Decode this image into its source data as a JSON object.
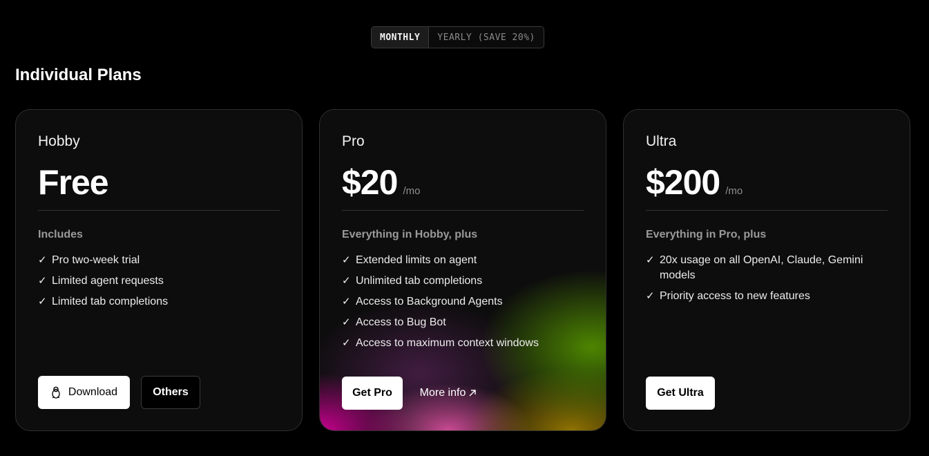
{
  "billing_toggle": {
    "monthly": "MONTHLY",
    "yearly": "YEARLY (SAVE 20%)"
  },
  "section_title": "Individual Plans",
  "plans": [
    {
      "name": "Hobby",
      "price": "Free",
      "per": "",
      "includes": "Includes",
      "features": [
        "Pro two-week trial",
        "Limited agent requests",
        "Limited tab completions"
      ],
      "primary_button": "Download",
      "secondary_button": "Others"
    },
    {
      "name": "Pro",
      "price": "$20",
      "per": "/mo",
      "includes": "Everything in Hobby, plus",
      "features": [
        "Extended limits on agent",
        "Unlimited tab completions",
        "Access to Background Agents",
        "Access to Bug Bot",
        "Access to maximum context windows"
      ],
      "primary_button": "Get Pro",
      "secondary_button": "More info",
      "secondary_icon": "arrow-up-right-icon"
    },
    {
      "name": "Ultra",
      "price": "$200",
      "per": "/mo",
      "includes": "Everything in Pro, plus",
      "features": [
        "20x usage on all OpenAI, Claude, Gemini models",
        "Priority access to new features"
      ],
      "primary_button": "Get Ultra"
    }
  ],
  "icons": {
    "check": "check-icon",
    "download": "linux-penguin-icon"
  },
  "check_glyph": "✓",
  "colors": {
    "background": "#000000",
    "card": "#0d0d0d",
    "muted": "#9a9a9a",
    "glow_green": "#5a8c00",
    "glow_magenta": "#d20096"
  }
}
